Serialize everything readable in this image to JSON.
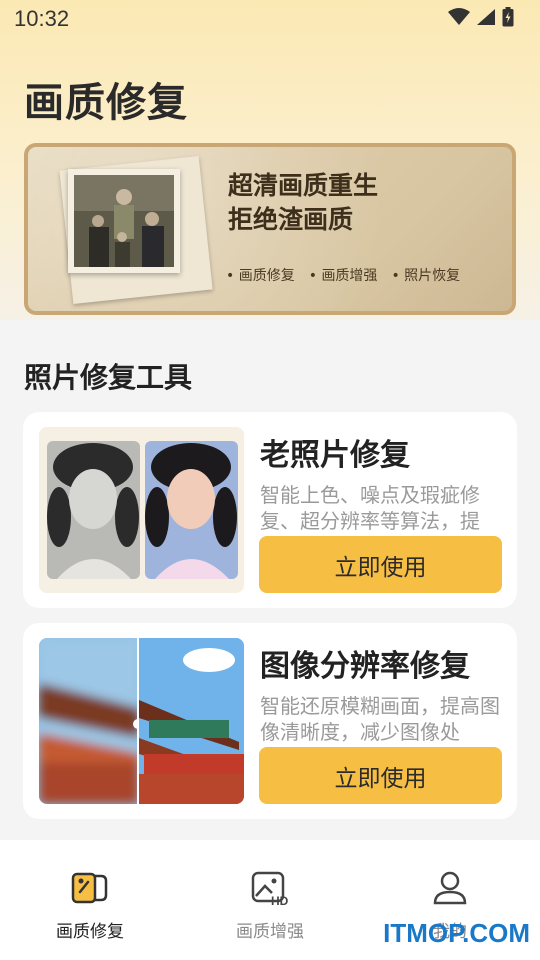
{
  "status_bar": {
    "time": "10:32",
    "icons": [
      "wifi-icon",
      "cellular-signal-icon",
      "battery-charging-icon"
    ]
  },
  "page_title": "画质修复",
  "banner": {
    "headline_line1": "超清画质重生",
    "headline_line2": "拒绝渣画质",
    "tags": [
      "画质修复",
      "画质增强",
      "照片恢复"
    ]
  },
  "section_title": "照片修复工具",
  "tools": [
    {
      "title": "老照片修复",
      "description": "智能上色、噪点及瑕疵修复、超分辨率等算法，提",
      "button_label": "立即使用"
    },
    {
      "title": "图像分辨率修复",
      "description": "智能还原模糊画面，提高图像清晰度，减少图像处",
      "button_label": "立即使用"
    }
  ],
  "tab_bar": {
    "tabs": [
      {
        "label": "画质修复",
        "icon": "photo-repair-icon",
        "active": true
      },
      {
        "label": "画质增强",
        "icon": "hd-image-icon",
        "active": false
      },
      {
        "label": "我的",
        "icon": "user-icon",
        "active": false
      }
    ]
  },
  "watermark": "ITMOP.COM",
  "colors": {
    "accent": "#f7be44",
    "header_gradient_top": "#fbe9b4",
    "background": "#f4f4f4"
  }
}
